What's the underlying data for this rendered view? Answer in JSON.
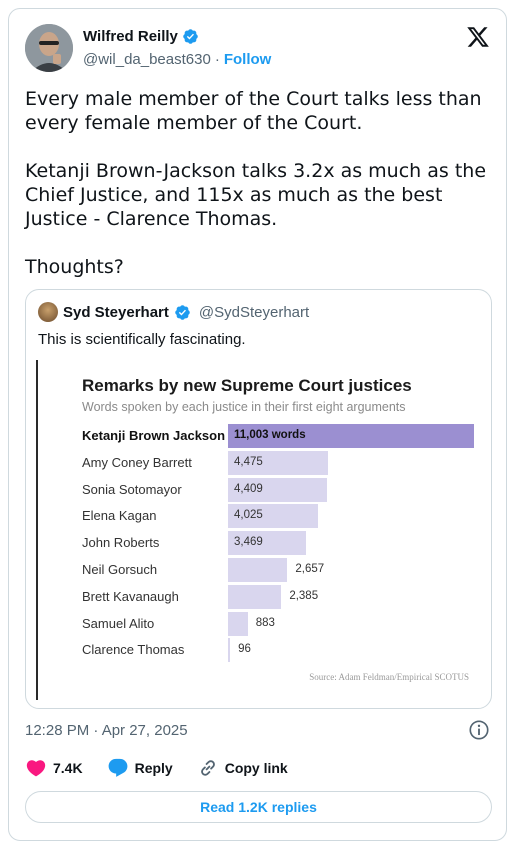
{
  "author": {
    "name": "Wilfred Reilly",
    "handle": "@wil_da_beast630",
    "separator": "·",
    "follow_label": "Follow"
  },
  "tweet": {
    "paragraphs": [
      "Every male member of the Court talks less than every female member of the Court.",
      "Ketanji Brown-Jackson talks 3.2x as much as the Chief Justice, and 115x as much as the best Justice - Clarence Thomas.",
      "Thoughts?"
    ]
  },
  "quote": {
    "name": "Syd Steyerhart",
    "handle": "@SydSteyerhart",
    "text": "This is scientifically fascinating."
  },
  "chart_data": {
    "type": "bar",
    "orientation": "horizontal",
    "title": "Remarks by new Supreme Court justices",
    "subtitle": "Words spoken by each justice in their first eight arguments",
    "categories": [
      "Ketanji Brown Jackson",
      "Amy Coney Barrett",
      "Sonia Sotomayor",
      "Elena Kagan",
      "John Roberts",
      "Neil Gorsuch",
      "Brett Kavanaugh",
      "Samuel Alito",
      "Clarence Thomas"
    ],
    "values": [
      11003,
      4475,
      4409,
      4025,
      3469,
      2657,
      2385,
      883,
      96
    ],
    "value_labels": [
      "11,003 words",
      "4,475",
      "4,409",
      "4,025",
      "3,469",
      "2,657",
      "2,385",
      "883",
      "96"
    ],
    "highlight_index": 0,
    "colors": {
      "highlight": "#9b8fd1",
      "default": "#d9d6ee"
    },
    "source": "Source: Adam Feldman/Empirical SCOTUS"
  },
  "meta": {
    "timestamp": "12:28 PM · Apr 27, 2025"
  },
  "actions": {
    "likes": "7.4K",
    "reply_label": "Reply",
    "copy_link_label": "Copy link",
    "read_replies_label": "Read 1.2K replies"
  },
  "colors": {
    "accent": "#1d9bf0",
    "like": "#f91880",
    "text": "#0f1419",
    "muted": "#536471"
  }
}
